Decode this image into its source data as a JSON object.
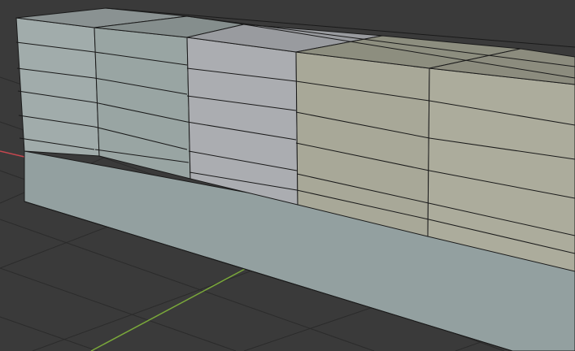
{
  "viewport": {
    "background_color": "#3a3a3a",
    "grid_line_color": "#2b2b2b",
    "edge_color": "#1a1a1a",
    "x_axis_color": "#c4474f",
    "y_axis_color": "#7aa83a"
  },
  "model": {
    "base_color": "#93a0a0",
    "face_colors": {
      "block_1": "#a1acab",
      "block_2": "#99a5a3",
      "block_3": "#abadb1",
      "block_4": "#a8a898",
      "block_5": "#acac9c"
    },
    "top_colors": {
      "block_1": "#8a9292",
      "block_2": "#858e8d",
      "block_3": "#999b9f",
      "block_4": "#8d8e7f",
      "block_5": "#8c8c7e"
    }
  }
}
